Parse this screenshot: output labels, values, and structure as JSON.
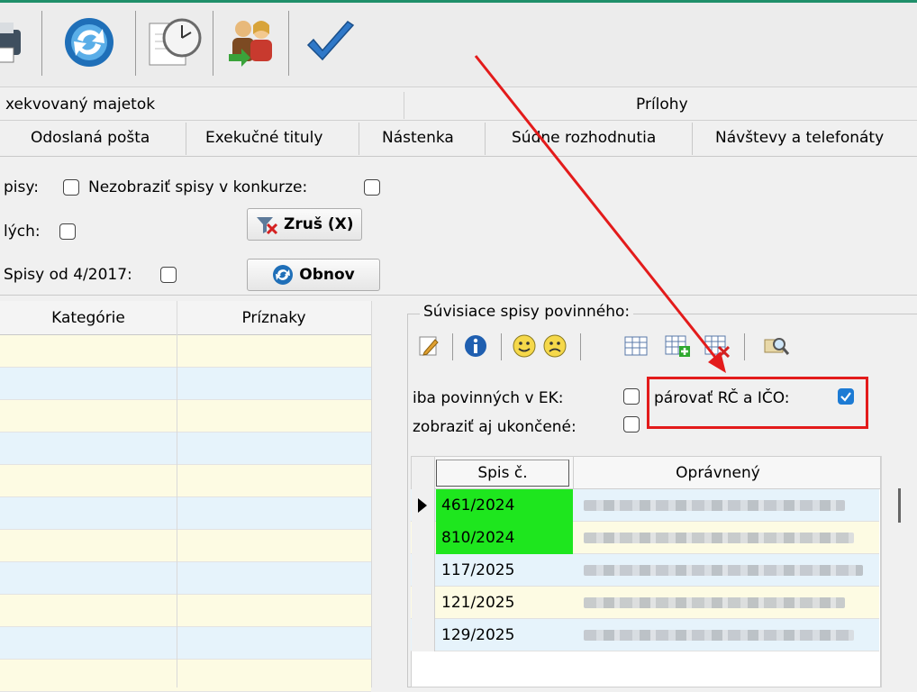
{
  "toolbar": {
    "icons": [
      "printer-icon",
      "refresh-icon",
      "clock-icon",
      "users-icon",
      "checkmark-icon"
    ]
  },
  "tabs_row1": {
    "left": "xekvovaný majetok",
    "right": "Prílohy"
  },
  "tabs_row2": [
    "Odoslaná pošta",
    "Exekučné tituly",
    "Nástenka",
    "Súdne rozhodnutia",
    "Návštevy a telefonáty"
  ],
  "filters": {
    "spisy_label": "pisy:",
    "nezobrazit_label": "Nezobraziť spisy v konkurze:",
    "elych_label": "lých:",
    "spisy_od_label": "Spisy od 4/2017:",
    "zrus_label": "Zruš (X)",
    "obnov_label": "Obnov"
  },
  "left_grid": {
    "columns": [
      "Kategórie",
      "Príznaky"
    ],
    "row_colors": [
      "#fdfbe3",
      "#e6f3fb"
    ]
  },
  "related": {
    "legend": "Súvisiace spisy povinného:",
    "iba_povinnych_label": "iba povinných v EK:",
    "parovat_label": "párovať RČ a IČO:",
    "zobrazit_label": "zobraziť aj ukončené:",
    "parovat_checked": true,
    "columns": [
      "Spis č.",
      "Oprávnený"
    ],
    "rows": [
      {
        "spis": "461/2024",
        "highlight": true,
        "current": true
      },
      {
        "spis": "810/2024",
        "highlight": true,
        "current": false
      },
      {
        "spis": "117/2025",
        "highlight": false,
        "current": false
      },
      {
        "spis": "121/2025",
        "highlight": false,
        "current": false
      },
      {
        "spis": "129/2025",
        "highlight": false,
        "current": false
      }
    ]
  },
  "colors": {
    "highlight_green": "#1ee61e",
    "annotation_red": "#e31b1b",
    "check_blue": "#1d7bd4"
  }
}
